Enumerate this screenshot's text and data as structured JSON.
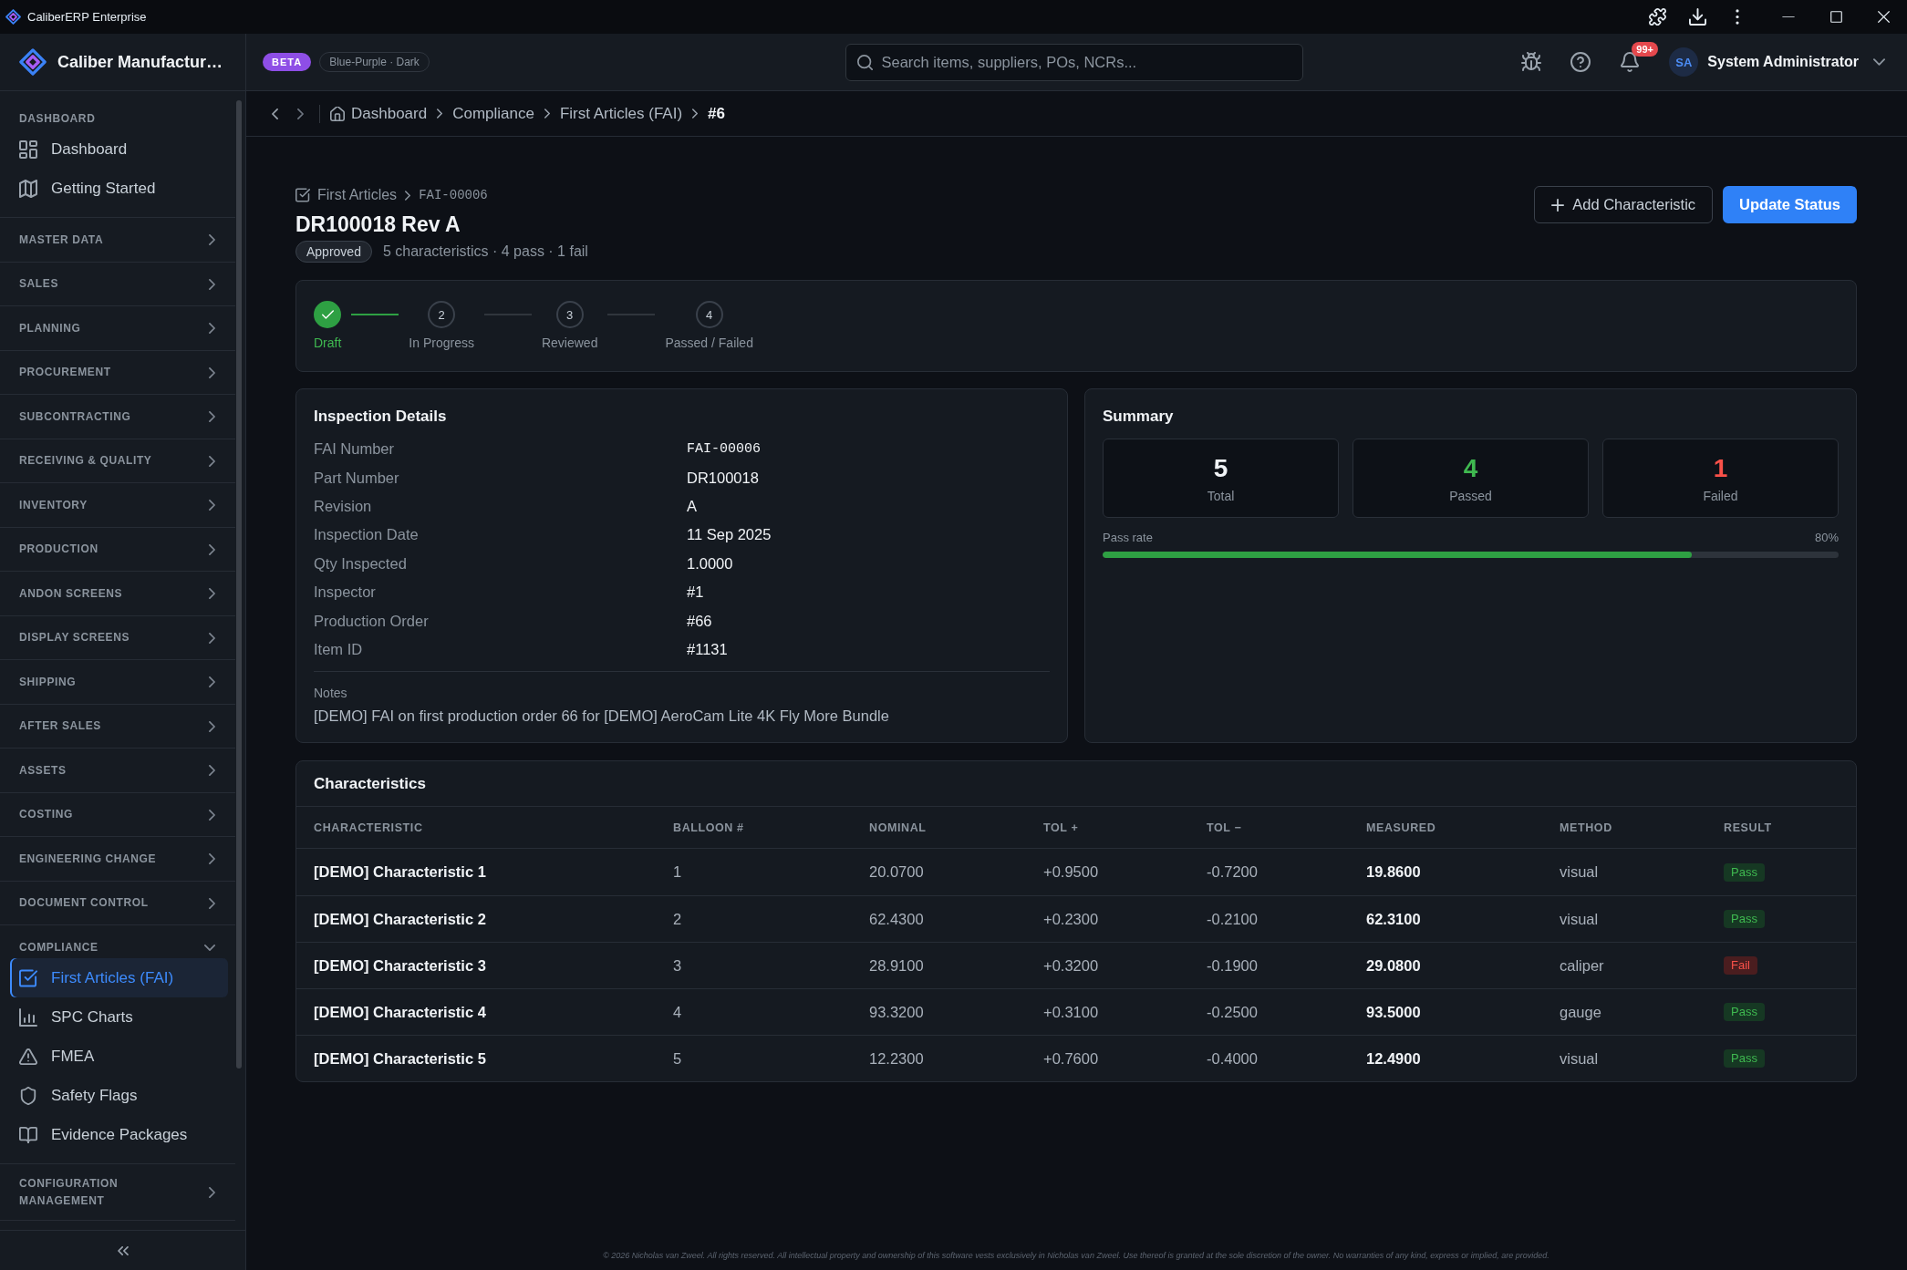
{
  "window": {
    "title": "CaliberERP Enterprise"
  },
  "header": {
    "brand": "Caliber Manufactur…",
    "beta_badge": "BETA",
    "theme_label": "Blue-Purple · Dark",
    "search": {
      "placeholder": "Search items, suppliers, POs, NCRs..."
    },
    "notification_count": "99+",
    "user": {
      "initials": "SA",
      "name": "System Administrator"
    }
  },
  "sidebar": {
    "sections": [
      {
        "label": "DASHBOARD",
        "kind": "heading",
        "items": [
          {
            "label": "Dashboard",
            "selected": false
          },
          {
            "label": "Getting Started",
            "selected": false
          }
        ]
      },
      {
        "label": "MASTER DATA",
        "kind": "group",
        "expanded": false
      },
      {
        "label": "SALES",
        "kind": "group",
        "expanded": false
      },
      {
        "label": "PLANNING",
        "kind": "group",
        "expanded": false
      },
      {
        "label": "PROCUREMENT",
        "kind": "group",
        "expanded": false
      },
      {
        "label": "SUBCONTRACTING",
        "kind": "group",
        "expanded": false
      },
      {
        "label": "RECEIVING & QUALITY",
        "kind": "group",
        "expanded": false
      },
      {
        "label": "INVENTORY",
        "kind": "group",
        "expanded": false
      },
      {
        "label": "PRODUCTION",
        "kind": "group",
        "expanded": false
      },
      {
        "label": "ANDON SCREENS",
        "kind": "group",
        "expanded": false
      },
      {
        "label": "DISPLAY SCREENS",
        "kind": "group",
        "expanded": false
      },
      {
        "label": "SHIPPING",
        "kind": "group",
        "expanded": false
      },
      {
        "label": "AFTER SALES",
        "kind": "group",
        "expanded": false
      },
      {
        "label": "ASSETS",
        "kind": "group",
        "expanded": false
      },
      {
        "label": "COSTING",
        "kind": "group",
        "expanded": false
      },
      {
        "label": "ENGINEERING CHANGE",
        "kind": "group",
        "expanded": false
      },
      {
        "label": "DOCUMENT CONTROL",
        "kind": "group",
        "expanded": false
      },
      {
        "label": "COMPLIANCE",
        "kind": "group",
        "expanded": true,
        "items": [
          {
            "label": "First Articles (FAI)",
            "selected": true
          },
          {
            "label": "SPC Charts",
            "selected": false
          },
          {
            "label": "FMEA",
            "selected": false
          },
          {
            "label": "Safety Flags",
            "selected": false
          },
          {
            "label": "Evidence Packages",
            "selected": false
          }
        ]
      },
      {
        "label": "CONFIGURATION MANAGEMENT",
        "kind": "group",
        "expanded": false
      }
    ]
  },
  "breadcrumb": [
    {
      "label": "Dashboard",
      "current": false
    },
    {
      "label": "Compliance",
      "current": false
    },
    {
      "label": "First Articles (FAI)",
      "current": false
    },
    {
      "label": "#6",
      "current": true
    }
  ],
  "page": {
    "crumbs": [
      {
        "label": "First Articles",
        "kind": "link"
      },
      {
        "label": "FAI-00006",
        "kind": "code"
      }
    ],
    "title": "DR100018 Rev A",
    "status": "Approved",
    "meta": "5 characteristics · 4 pass · 1 fail",
    "actions": [
      {
        "label": "Add Characteristic",
        "kind": "secondary"
      },
      {
        "label": "Update Status",
        "kind": "primary"
      }
    ]
  },
  "workflow_steps": [
    {
      "label": "Draft",
      "complete": true
    },
    {
      "number": "2",
      "label": "In Progress",
      "complete": false
    },
    {
      "number": "3",
      "label": "Reviewed",
      "complete": false
    },
    {
      "number": "4",
      "label": "Passed / Failed",
      "complete": false
    }
  ],
  "inspection_details": {
    "title": "Inspection Details",
    "fields": [
      {
        "label": "FAI Number",
        "value": "FAI-00006",
        "kind": "code"
      },
      {
        "label": "Part Number",
        "value": "DR100018",
        "kind": "text"
      },
      {
        "label": "Revision",
        "value": "A",
        "kind": "text"
      },
      {
        "label": "Inspection Date",
        "value": "11 Sep 2025",
        "kind": "text"
      },
      {
        "label": "Qty Inspected",
        "value": "1.0000",
        "kind": "text"
      },
      {
        "label": "Inspector",
        "value": "#1",
        "kind": "text"
      },
      {
        "label": "Production Order",
        "value": "#66",
        "kind": "text"
      },
      {
        "label": "Item ID",
        "value": "#1131",
        "kind": "text"
      }
    ],
    "notes": {
      "label": "Notes",
      "text": "[DEMO] FAI on first production order 66 for [DEMO] AeroCam Lite 4K Fly More Bundle"
    }
  },
  "summary": {
    "title": "Summary",
    "stats": [
      {
        "value": "5",
        "label": "Total",
        "kind": "total"
      },
      {
        "value": "4",
        "label": "Passed",
        "kind": "passed"
      },
      {
        "value": "1",
        "label": "Failed",
        "kind": "failed"
      }
    ],
    "pass_rate": {
      "label": "Pass rate",
      "reading": "80%",
      "level": 0.8
    }
  },
  "characteristics": {
    "title": "Characteristics",
    "columns": [
      "CHARACTERISTIC",
      "BALLOON #",
      "NOMINAL",
      "TOL +",
      "TOL −",
      "MEASURED",
      "METHOD",
      "RESULT"
    ],
    "rows": [
      {
        "characteristic": "[DEMO] Characteristic 1",
        "balloon": "1",
        "nominal": "20.0700",
        "tol_plus": "+0.9500",
        "tol_minus": "-0.7200",
        "measured": "19.8600",
        "method": "visual",
        "result": {
          "label": "Pass",
          "passed": true
        }
      },
      {
        "characteristic": "[DEMO] Characteristic 2",
        "balloon": "2",
        "nominal": "62.4300",
        "tol_plus": "+0.2300",
        "tol_minus": "-0.2100",
        "measured": "62.3100",
        "method": "visual",
        "result": {
          "label": "Pass",
          "passed": true
        }
      },
      {
        "characteristic": "[DEMO] Characteristic 3",
        "balloon": "3",
        "nominal": "28.9100",
        "tol_plus": "+0.3200",
        "tol_minus": "-0.1900",
        "measured": "29.0800",
        "method": "caliper",
        "result": {
          "label": "Fail",
          "passed": false
        }
      },
      {
        "characteristic": "[DEMO] Characteristic 4",
        "balloon": "4",
        "nominal": "93.3200",
        "tol_plus": "+0.3100",
        "tol_minus": "-0.2500",
        "measured": "93.5000",
        "method": "gauge",
        "result": {
          "label": "Pass",
          "passed": true
        }
      },
      {
        "characteristic": "[DEMO] Characteristic 5",
        "balloon": "5",
        "nominal": "12.2300",
        "tol_plus": "+0.7600",
        "tol_minus": "-0.4000",
        "measured": "12.4900",
        "method": "visual",
        "result": {
          "label": "Pass",
          "passed": true
        }
      }
    ]
  },
  "footer": {
    "text": "© 2026 Nicholas van Zweel. All rights reserved. All intellectual property and ownership of this software vests exclusively in Nicholas van Zweel. Use thereof is granted at the sole discretion of the owner. No warranties of any kind, express or implied, are provided."
  }
}
